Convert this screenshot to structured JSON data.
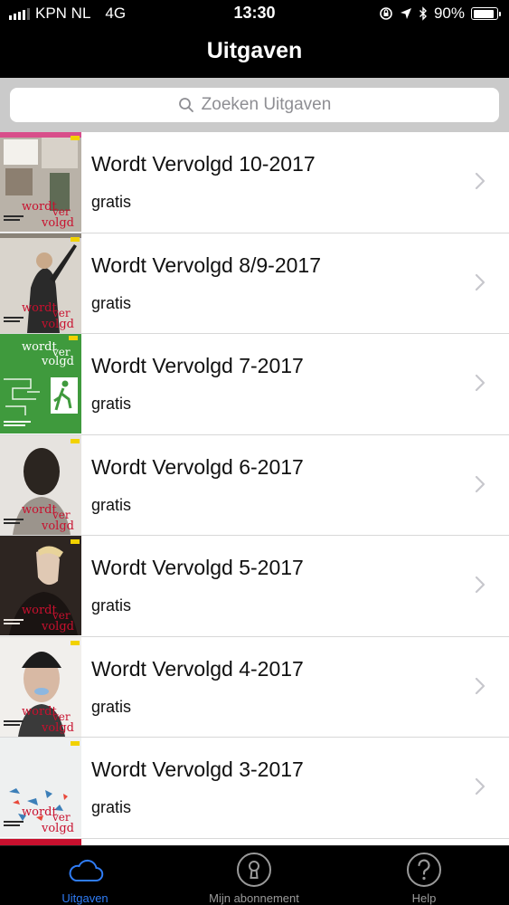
{
  "status_bar": {
    "carrier": "KPN NL",
    "network": "4G",
    "time": "13:30",
    "battery": "90%",
    "battery_level": 0.9
  },
  "nav": {
    "title": "Uitgaven"
  },
  "search": {
    "placeholder": "Zoeken Uitgaven"
  },
  "issues": [
    {
      "title": "Wordt Vervolgd 10-2017",
      "price": "gratis",
      "cover_icon": "magazine-cover-storefront"
    },
    {
      "title": "Wordt Vervolgd 8/9-2017",
      "price": "gratis",
      "cover_icon": "magazine-cover-protester"
    },
    {
      "title": "Wordt Vervolgd 7-2017",
      "price": "gratis",
      "cover_icon": "magazine-cover-exit-sign"
    },
    {
      "title": "Wordt Vervolgd 6-2017",
      "price": "gratis",
      "cover_icon": "magazine-cover-portrait"
    },
    {
      "title": "Wordt Vervolgd 5-2017",
      "price": "gratis",
      "cover_icon": "magazine-cover-trump"
    },
    {
      "title": "Wordt Vervolgd 4-2017",
      "price": "gratis",
      "cover_icon": "magazine-cover-woman-beanie"
    },
    {
      "title": "Wordt Vervolgd 3-2017",
      "price": "gratis",
      "cover_icon": "magazine-cover-birds"
    }
  ],
  "tabs": [
    {
      "label": "Uitgaven",
      "icon": "cloud-icon",
      "active": true
    },
    {
      "label": "Mijn abonnement",
      "icon": "keyhole-icon",
      "active": false
    },
    {
      "label": "Help",
      "icon": "question-icon",
      "active": false
    }
  ],
  "colors": {
    "accent": "#2f7cf6",
    "cover_brand_red": "#c8102e",
    "search_bg": "#cacaca"
  },
  "cover_masthead": {
    "line1": "wordt",
    "line2": "ver",
    "line3": "volgd"
  }
}
